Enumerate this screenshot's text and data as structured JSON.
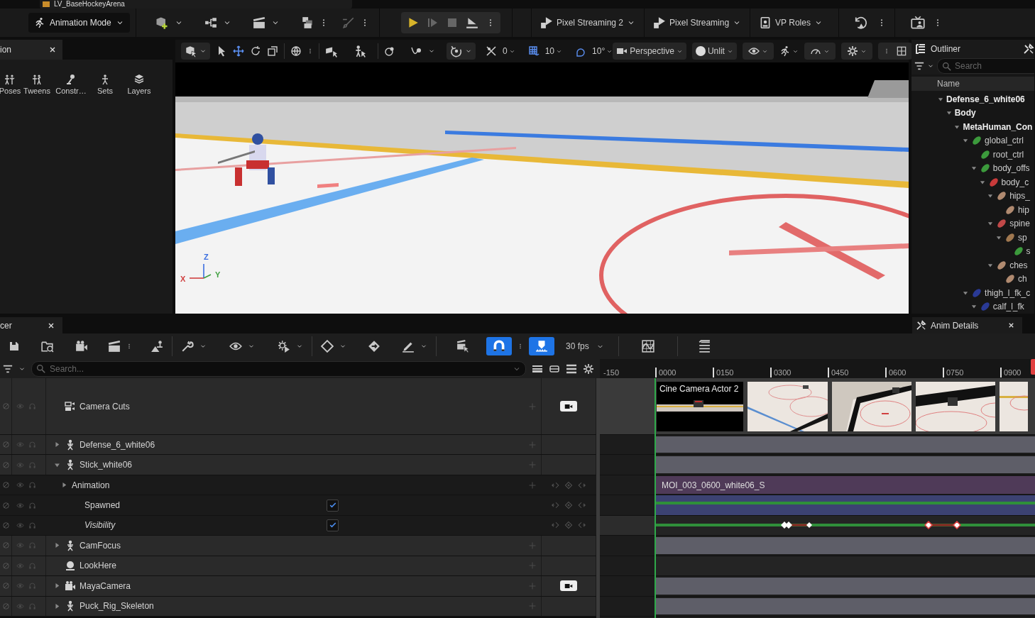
{
  "document_tab": {
    "title": "LV_BaseHockeyArena"
  },
  "main_toolbar": {
    "mode": "Animation Mode",
    "buttons": [
      {
        "kind": "streaming",
        "label": "Pixel Streaming 2"
      },
      {
        "kind": "streaming",
        "label": "Pixel Streaming"
      },
      {
        "kind": "roles",
        "label": "VP Roles"
      }
    ]
  },
  "left_panel": {
    "tab": "ion",
    "tools": [
      {
        "kind": "poses",
        "label": "Poses"
      },
      {
        "kind": "tweens",
        "label": "Tweens"
      },
      {
        "kind": "constraints",
        "label": "Constr…"
      },
      {
        "kind": "sets",
        "label": "Sets"
      },
      {
        "kind": "layers",
        "label": "Layers"
      }
    ]
  },
  "viewport": {
    "surface_snap": "0",
    "grid_snap": "10",
    "rotation_snap": "10°",
    "view_mode": "Perspective",
    "lighting": "Unlit",
    "axes": {
      "z": "Z",
      "x": "X",
      "y": "Y"
    }
  },
  "outliner": {
    "title": "Outliner",
    "search_placeholder": "Search",
    "column": "Name",
    "tree": [
      {
        "kind": "actor",
        "name": "Defense_6_white06",
        "expanded": true,
        "children": [
          {
            "kind": "actor",
            "name": "Body",
            "expanded": true,
            "children": [
              {
                "kind": "actor",
                "name": "MetaHuman_Con",
                "expanded": true,
                "children": [
                  {
                    "kind": "control",
                    "name": "global_ctrl",
                    "color": "#3c9a3c",
                    "expanded": true,
                    "children": [
                      {
                        "kind": "control",
                        "name": "root_ctrl",
                        "color": "#3c9a3c"
                      },
                      {
                        "kind": "control",
                        "name": "body_offs",
                        "color": "#3c9a3c",
                        "expanded": true,
                        "children": [
                          {
                            "kind": "control",
                            "name": "body_c",
                            "color": "#c83a3a",
                            "expanded": true,
                            "children": [
                              {
                                "kind": "control",
                                "name": "hips_",
                                "color": "#b08a70",
                                "expanded": true,
                                "children": [
                                  {
                                    "kind": "control",
                                    "name": "hip",
                                    "color": "#b08a70"
                                  }
                                ]
                              },
                              {
                                "kind": "control",
                                "name": "spine",
                                "color": "#c04848",
                                "expanded": true,
                                "children": [
                                  {
                                    "kind": "control",
                                    "name": "sp",
                                    "color": "#a07850",
                                    "expanded": true,
                                    "children": [
                                      {
                                        "kind": "control",
                                        "name": "s",
                                        "color": "#3c9a3c"
                                      }
                                    ]
                                  }
                                ]
                              },
                              {
                                "kind": "control",
                                "name": "ches",
                                "color": "#b08a70",
                                "expanded": true,
                                "children": [
                                  {
                                    "kind": "control",
                                    "name": "ch",
                                    "color": "#b08a70"
                                  }
                                ]
                              }
                            ]
                          }
                        ]
                      }
                    ]
                  },
                  {
                    "kind": "control",
                    "name": "thigh_l_fk_c",
                    "color": "#2a3a96",
                    "expanded": true,
                    "children": [
                      {
                        "kind": "control",
                        "name": "calf_l_fk",
                        "color": "#2a3a96",
                        "expanded": true
                      }
                    ]
                  }
                ]
              }
            ]
          }
        ]
      }
    ]
  },
  "anim_details": {
    "title": "Anim Details"
  },
  "sequencer": {
    "tab": "cer",
    "frame_rate": "30 fps",
    "snap_toggles": [
      {
        "kind": "magnet",
        "on": true
      },
      {
        "kind": "playhead",
        "on": true
      }
    ],
    "search_placeholder": "Search...",
    "ruler": [
      "-150",
      "0000",
      "0150",
      "0300",
      "0450",
      "0600",
      "0750",
      "0900"
    ],
    "tracks": [
      {
        "kind": "camera_cuts",
        "name": "Camera Cuts",
        "camera_lock": true,
        "section": "Cine Camera Actor 2"
      },
      {
        "kind": "skeletal",
        "name": "Defense_6_white06",
        "expanded": false,
        "camera_lock": false
      },
      {
        "kind": "skeletal",
        "name": "Stick_white06",
        "expanded": true,
        "camera_lock": false,
        "children": [
          {
            "kind": "animation",
            "name": "Animation",
            "expanded": false,
            "section": "MOI_003_0600_white06_S"
          },
          {
            "kind": "bool",
            "name": "Spawned",
            "checked": true,
            "keyed": false
          },
          {
            "kind": "bool",
            "name": "Visibility",
            "checked": true,
            "keyed": true
          }
        ]
      },
      {
        "kind": "skeletal",
        "name": "CamFocus",
        "expanded": false,
        "camera_lock": false
      },
      {
        "kind": "sphere",
        "name": "LookHere",
        "camera_lock": false
      },
      {
        "kind": "camera",
        "name": "MayaCamera",
        "expanded": false,
        "camera_lock": true
      },
      {
        "kind": "skeletal",
        "name": "Puck_Rig_Skeleton",
        "expanded": false,
        "camera_lock": false
      }
    ]
  }
}
